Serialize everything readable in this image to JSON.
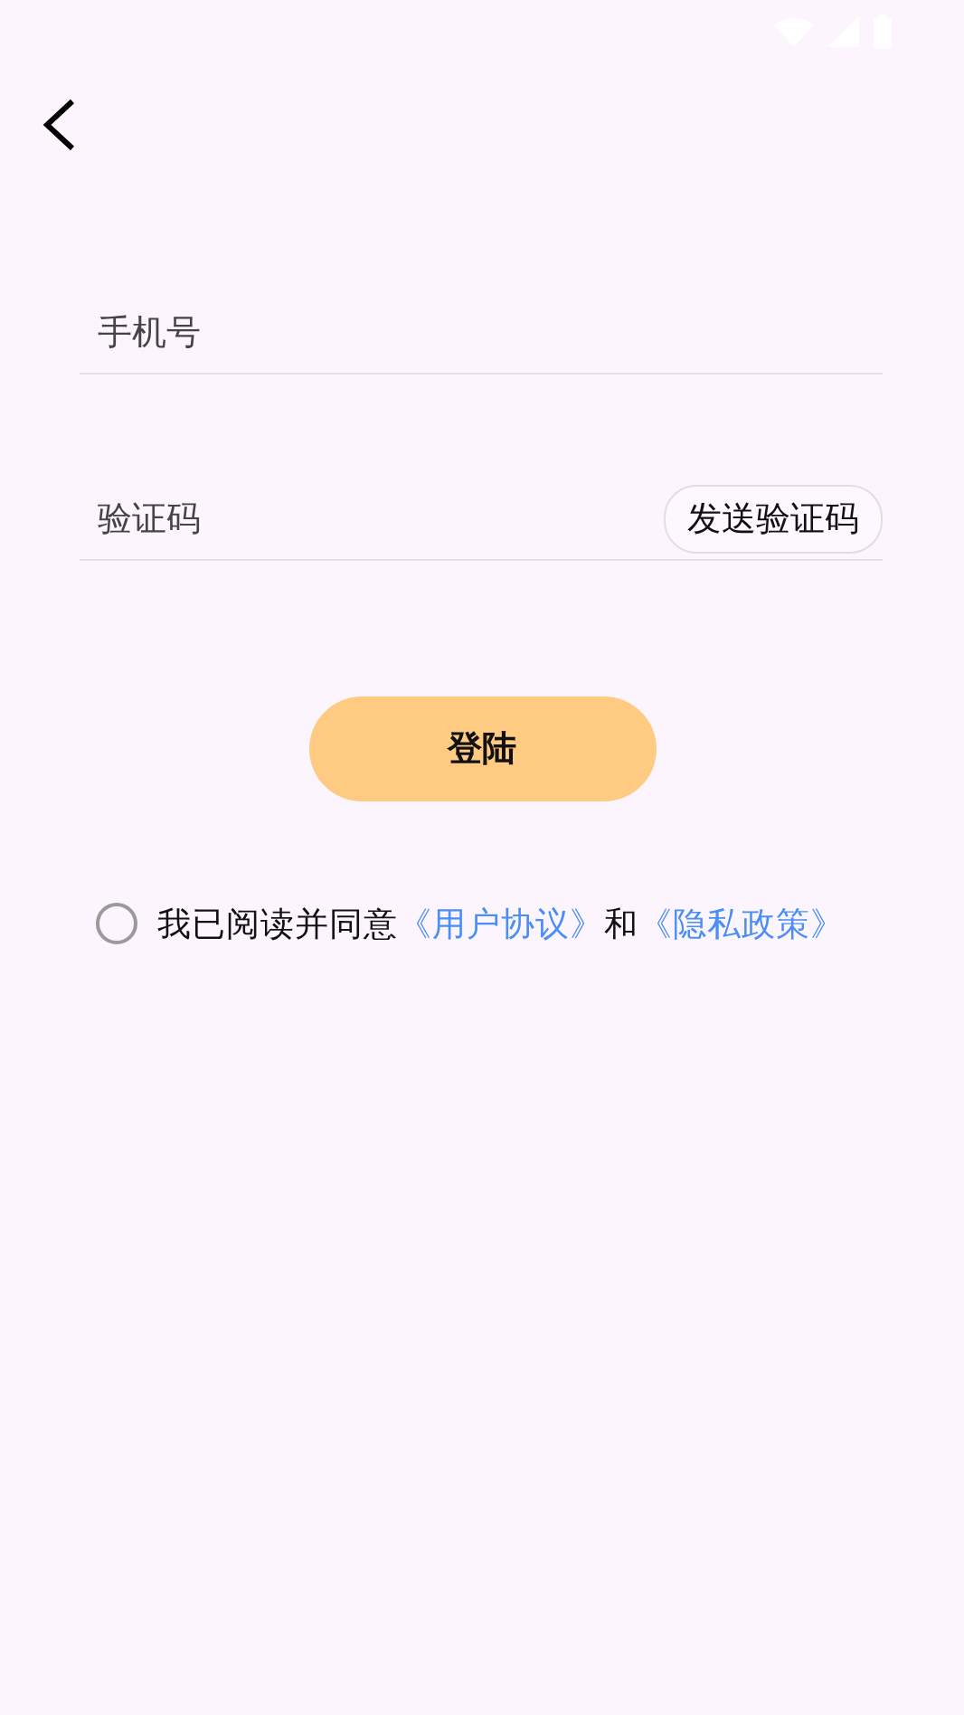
{
  "phone_field": {
    "placeholder": "手机号"
  },
  "code_field": {
    "placeholder": "验证码",
    "send_button": "发送验证码"
  },
  "login_button": "登陆",
  "agreement": {
    "checked": false,
    "prefix": "我已阅读并同意",
    "user_agreement": "《用户协议》",
    "conjunction": "和",
    "privacy_policy": "《隐私政策》"
  }
}
